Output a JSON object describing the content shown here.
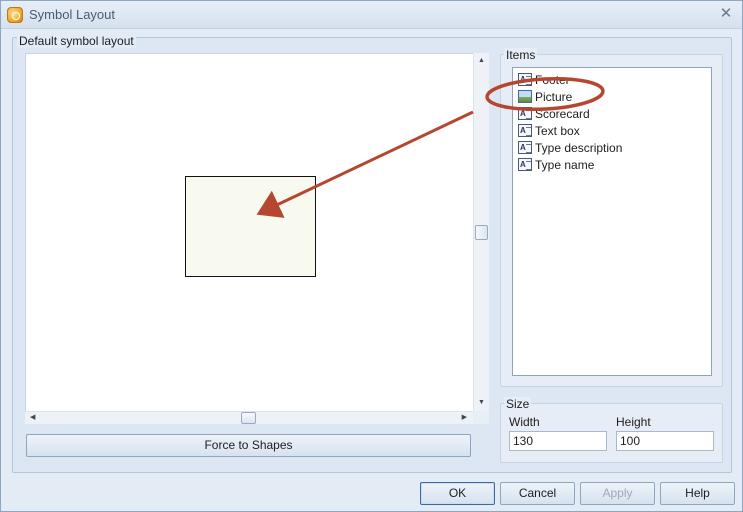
{
  "window": {
    "title": "Symbol Layout",
    "close_glyph": "✕",
    "app_icon": "symbol-layout-app-icon"
  },
  "layout_group": {
    "label": "Default symbol layout"
  },
  "canvas": {
    "background": "#ffffff",
    "symbol_fill": "#f8faf0"
  },
  "force_button": {
    "label": "Force to Shapes"
  },
  "items_group": {
    "label": "Items",
    "items": [
      {
        "label": "Footer",
        "icon": "text-item-icon"
      },
      {
        "label": "Picture",
        "icon": "picture-item-icon"
      },
      {
        "label": "Scorecard",
        "icon": "text-item-icon"
      },
      {
        "label": "Text box",
        "icon": "text-item-icon"
      },
      {
        "label": "Type description",
        "icon": "text-item-icon"
      },
      {
        "label": "Type name",
        "icon": "text-item-icon"
      }
    ]
  },
  "size_group": {
    "label": "Size",
    "width_label": "Width",
    "width_value": "130",
    "height_label": "Height",
    "height_value": "100"
  },
  "buttons": {
    "ok": "OK",
    "cancel": "Cancel",
    "apply": "Apply",
    "help": "Help"
  },
  "annotation": {
    "color": "#b5462f"
  }
}
